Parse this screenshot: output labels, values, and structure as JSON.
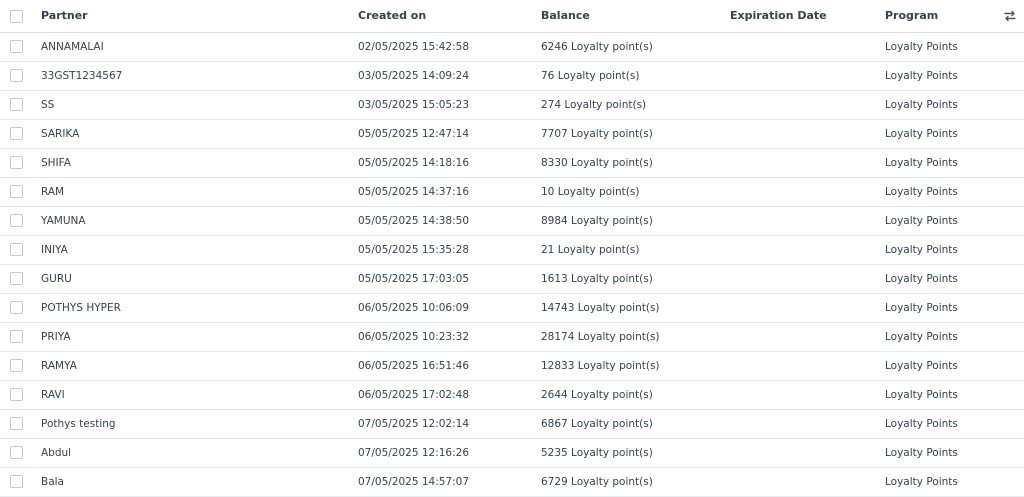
{
  "columns": {
    "partner": "Partner",
    "created_on": "Created on",
    "balance": "Balance",
    "expiration_date": "Expiration Date",
    "program": "Program"
  },
  "optional_columns_icon": "sliders-toggle-icon",
  "rows": [
    {
      "partner": "ANNAMALAI",
      "created_on": "02/05/2025 15:42:58",
      "balance": "6246 Loyalty point(s)",
      "expiration_date": "",
      "program": "Loyalty Points"
    },
    {
      "partner": "33GST1234567",
      "created_on": "03/05/2025 14:09:24",
      "balance": "76 Loyalty point(s)",
      "expiration_date": "",
      "program": "Loyalty Points"
    },
    {
      "partner": "SS",
      "created_on": "03/05/2025 15:05:23",
      "balance": "274 Loyalty point(s)",
      "expiration_date": "",
      "program": "Loyalty Points"
    },
    {
      "partner": "SARIKA",
      "created_on": "05/05/2025 12:47:14",
      "balance": "7707 Loyalty point(s)",
      "expiration_date": "",
      "program": "Loyalty Points"
    },
    {
      "partner": "SHIFA",
      "created_on": "05/05/2025 14:18:16",
      "balance": "8330 Loyalty point(s)",
      "expiration_date": "",
      "program": "Loyalty Points"
    },
    {
      "partner": "RAM",
      "created_on": "05/05/2025 14:37:16",
      "balance": "10 Loyalty point(s)",
      "expiration_date": "",
      "program": "Loyalty Points"
    },
    {
      "partner": "YAMUNA",
      "created_on": "05/05/2025 14:38:50",
      "balance": "8984 Loyalty point(s)",
      "expiration_date": "",
      "program": "Loyalty Points"
    },
    {
      "partner": "INIYA",
      "created_on": "05/05/2025 15:35:28",
      "balance": "21 Loyalty point(s)",
      "expiration_date": "",
      "program": "Loyalty Points"
    },
    {
      "partner": "GURU",
      "created_on": "05/05/2025 17:03:05",
      "balance": "1613 Loyalty point(s)",
      "expiration_date": "",
      "program": "Loyalty Points"
    },
    {
      "partner": "POTHYS HYPER",
      "created_on": "06/05/2025 10:06:09",
      "balance": "14743 Loyalty point(s)",
      "expiration_date": "",
      "program": "Loyalty Points"
    },
    {
      "partner": "PRIYA",
      "created_on": "06/05/2025 10:23:32",
      "balance": "28174 Loyalty point(s)",
      "expiration_date": "",
      "program": "Loyalty Points"
    },
    {
      "partner": "RAMYA",
      "created_on": "06/05/2025 16:51:46",
      "balance": "12833 Loyalty point(s)",
      "expiration_date": "",
      "program": "Loyalty Points"
    },
    {
      "partner": "RAVI",
      "created_on": "06/05/2025 17:02:48",
      "balance": "2644 Loyalty point(s)",
      "expiration_date": "",
      "program": "Loyalty Points"
    },
    {
      "partner": "Pothys testing",
      "created_on": "07/05/2025 12:02:14",
      "balance": "6867 Loyalty point(s)",
      "expiration_date": "",
      "program": "Loyalty Points"
    },
    {
      "partner": "Abdul",
      "created_on": "07/05/2025 12:16:26",
      "balance": "5235 Loyalty point(s)",
      "expiration_date": "",
      "program": "Loyalty Points"
    },
    {
      "partner": "Bala",
      "created_on": "07/05/2025 14:57:07",
      "balance": "6729 Loyalty point(s)",
      "expiration_date": "",
      "program": "Loyalty Points"
    }
  ]
}
